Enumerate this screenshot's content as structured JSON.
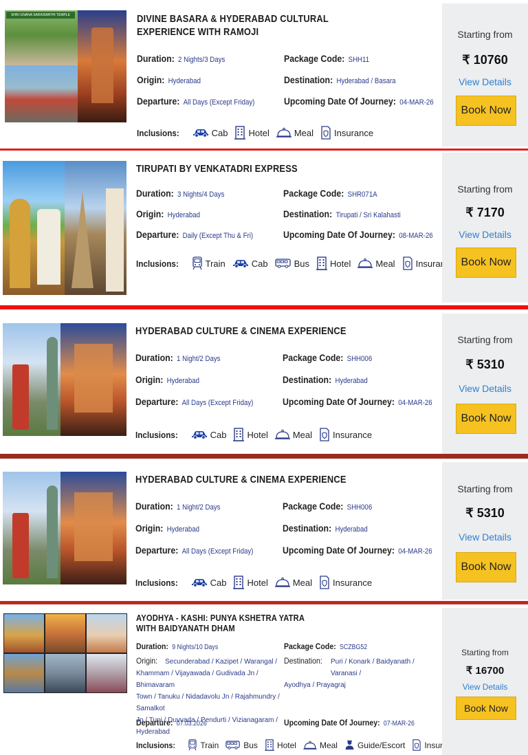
{
  "labels": {
    "duration": "Duration:",
    "origin": "Origin:",
    "departure": "Departure:",
    "package_code": "Package Code:",
    "destination": "Destination:",
    "upcoming": "Upcoming Date Of Journey:",
    "inclusions": "Inclusions:",
    "starting_from": "Starting from",
    "view_details": "View Details",
    "book_now": "Book Now"
  },
  "inclusion_names": {
    "cab": "Cab",
    "hotel": "Hotel",
    "meal": "Meal",
    "insurance": "Insurance",
    "train": "Train",
    "bus": "Bus",
    "guide": "Guide/Escort"
  },
  "thumb_text": "SHRI GNANA SARASWATHI TEMPLE",
  "packages": [
    {
      "title1": "DIVINE BASARA & HYDERABAD CULTURAL",
      "title2": "EXPERIENCE WITH RAMOJI",
      "duration": "2 Nights/3 Days",
      "origin": "Hyderabad",
      "departure": "All Days (Except Friday)",
      "package_code": "SHH11",
      "destination": "Hyderabad / Basara",
      "upcoming": "04-MAR-26",
      "price": "₹ 10760"
    },
    {
      "title1": "TIRUPATI BY VENKATADRI EXPRESS",
      "duration": "3 Nights/4 Days",
      "origin": "Hyderabad",
      "departure": "Daily (Except Thu & Fri)",
      "package_code": "SHR071A",
      "destination": "Tirupati / Sri Kalahasti",
      "upcoming": "08-MAR-26",
      "price": "₹ 7170"
    },
    {
      "title1": "HYDERABAD CULTURE & CINEMA EXPERIENCE",
      "duration": "1 Night/2 Days",
      "origin": "Hyderabad",
      "departure": "All Days (Except Friday)",
      "package_code": "SHH006",
      "destination": "Hyderabad",
      "upcoming": "04-MAR-26",
      "price": "₹ 5310"
    },
    {
      "title1": "HYDERABAD CULTURE & CINEMA EXPERIENCE",
      "duration": "1 Night/2 Days",
      "origin": "Hyderabad",
      "departure": "All Days (Except Friday)",
      "package_code": "SHH006",
      "destination": "Hyderabad",
      "upcoming": "04-MAR-26",
      "price": "₹ 5310"
    },
    {
      "title1": "AYODHYA - KASHI: PUNYA KSHETRA YATRA",
      "title2": "WITH BAIDYANATH DHAM",
      "duration": "9 Nights/10 Days",
      "origin_lines": [
        "Secunderabad / Kazipet / Warangal /",
        "Khammam / Vijayawada / Gudivada Jn / Bhimavaram",
        "Town / Tanuku / Nidadavolu Jn / Rajahmundry / Samalkot",
        "Jn / Tuni / Duvvada / Pendurti / Vizianagaram /",
        "Hyderabad"
      ],
      "departure": "07.03.2026",
      "package_code": "SCZBG52",
      "destination_lines": [
        "Puri / Konark / Baidyanath / Varanasi /",
        "Ayodhya / Prayagraj"
      ],
      "upcoming": "07-MAR-26",
      "price": "₹ 16700"
    }
  ]
}
